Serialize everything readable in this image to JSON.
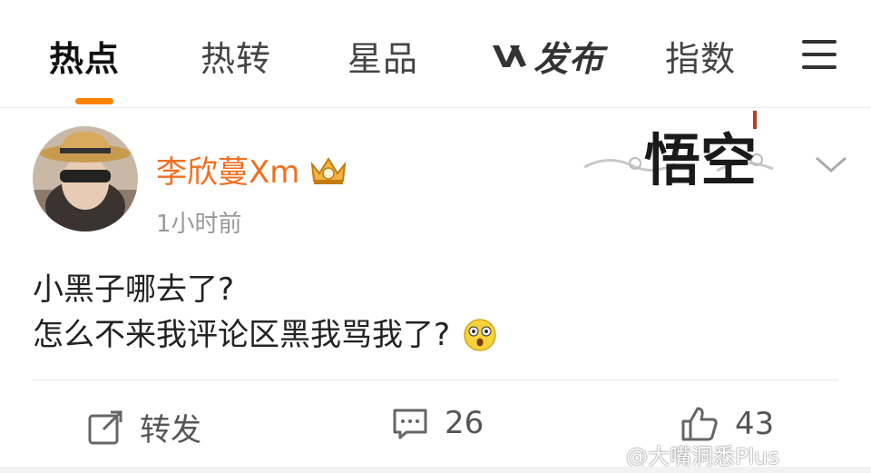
{
  "tabs": {
    "hot": "热点",
    "hot_repost": "热转",
    "star_products": "星品",
    "v_publish": "发布",
    "index": "指数"
  },
  "post": {
    "username": "李欣蔓Xm",
    "time": "1小时前",
    "line1": "小黑子哪去了?",
    "line2": "怎么不来我评论区黑我骂我了?",
    "decoration_text": "悟空"
  },
  "actions": {
    "repost_label": "转发",
    "comment_count": "26",
    "like_count": "43"
  },
  "watermark": "@大嘴洞悉Plus",
  "colors": {
    "accent": "#ff8200",
    "username": "#f06f20"
  }
}
